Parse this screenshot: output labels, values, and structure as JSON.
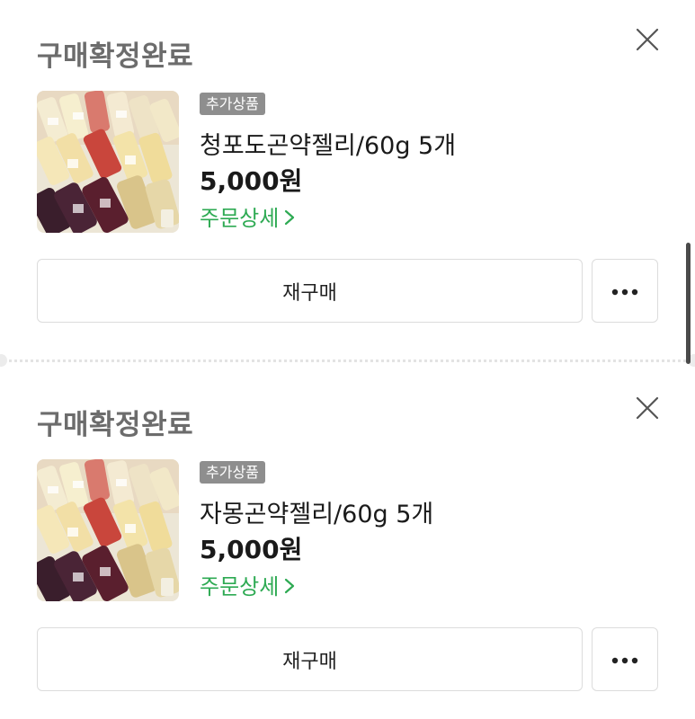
{
  "orders": [
    {
      "status": "구매확정완료",
      "badge": "추가상품",
      "product_name": "청포도곤약젤리/60g 5개",
      "price": "5,000원",
      "detail_link": "주문상세",
      "rebuy_label": "재구매",
      "thumbnail": "jelly-pouches-photo"
    },
    {
      "status": "구매확정완료",
      "badge": "추가상품",
      "product_name": "자몽곤약젤리/60g 5개",
      "price": "5,000원",
      "detail_link": "주문상세",
      "rebuy_label": "재구매",
      "thumbnail": "jelly-pouches-photo"
    }
  ],
  "icons": {
    "close": "close-icon",
    "more": "more-dots-icon",
    "chevron": "chevron-right-icon"
  },
  "colors": {
    "status_text": "#6c6c6c",
    "badge_bg": "#8e8e8e",
    "link_green": "#2eaa53",
    "border": "#dcdcdc"
  }
}
